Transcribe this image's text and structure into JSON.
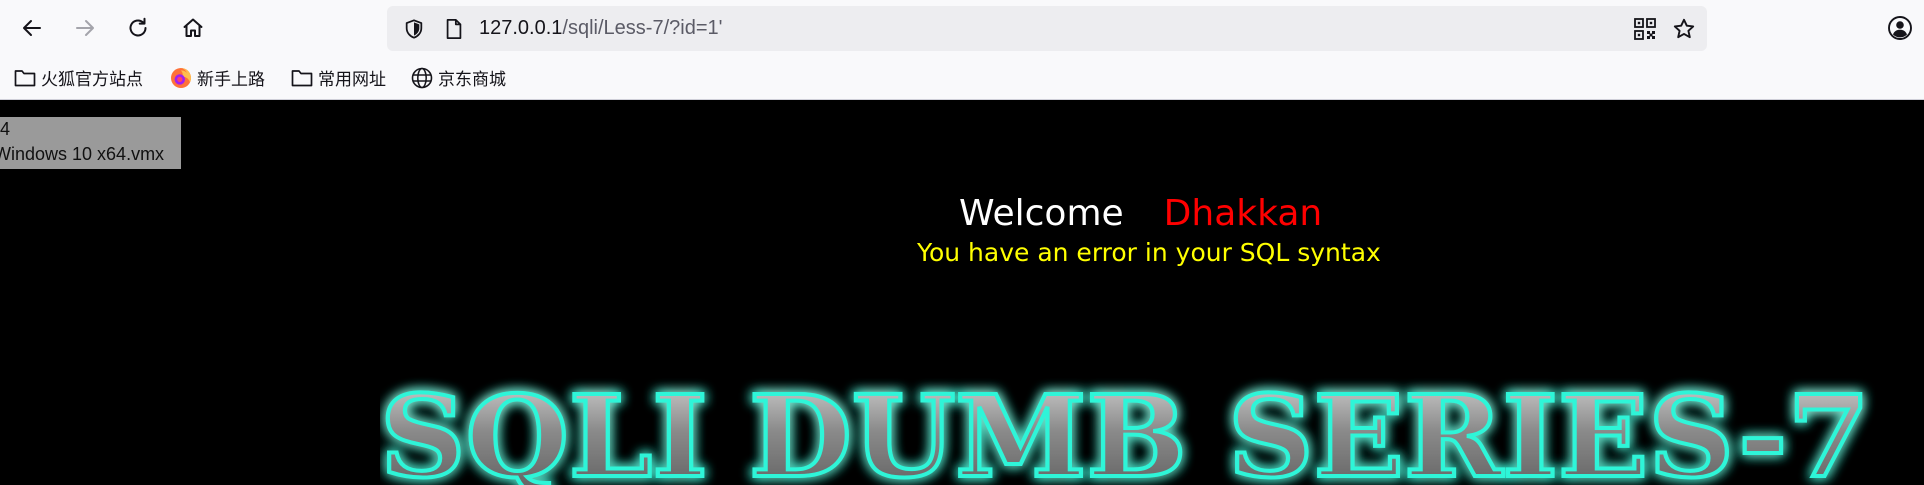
{
  "toolbar": {
    "back_icon": "arrow-left-icon",
    "forward_icon": "arrow-right-icon",
    "reload_icon": "reload-icon",
    "home_icon": "home-icon",
    "url": {
      "host": "127.0.0.1",
      "path": "/sqli/Less-7/?id=1'"
    },
    "tracking_icon": "shield-icon",
    "page_icon": "page-icon",
    "qr_icon": "qr-code-icon",
    "bookmark_star_icon": "star-icon",
    "account_icon": "account-icon"
  },
  "bookmarks": [
    {
      "label": "火狐官方站点",
      "icon": "folder-icon"
    },
    {
      "label": "新手上路",
      "icon": "firefox-icon"
    },
    {
      "label": "常用网址",
      "icon": "folder-icon"
    },
    {
      "label": "京东商城",
      "icon": "globe-icon"
    }
  ],
  "page": {
    "tooltip_lines": [
      "4",
      "Windows 10 x64.vmx"
    ],
    "welcome": "Welcome",
    "username": "Dhakkan",
    "message": "You have an error in your SQL syntax",
    "banner": "SQLI DUMB SERIES-7"
  },
  "colors": {
    "page_background": "#000000",
    "welcome": "#ffffff",
    "username": "#ff0000",
    "message": "#ffff00",
    "banner_glow": "#2ff5d8"
  }
}
